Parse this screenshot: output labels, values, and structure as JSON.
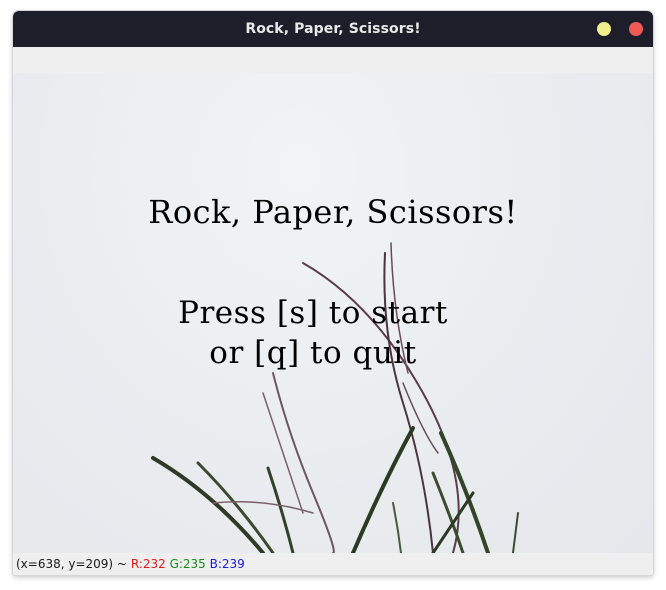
{
  "window": {
    "title": "Rock, Paper, Scissors!"
  },
  "canvas": {
    "game_title": "Rock, Paper, Scissors!",
    "instruction_line1": "Press [s] to start",
    "instruction_line2": "or [q] to quit"
  },
  "status": {
    "coords": "(x=638, y=209) ~",
    "r": "R:232",
    "g": "G:235",
    "b": "B:239"
  },
  "colors": {
    "titlebar": "#1e1e2a",
    "minimize": "#f1f08c",
    "close": "#ef5a57",
    "r_label": "#e01b1b",
    "g_label": "#1c8a1c",
    "b_label": "#1a1ae0"
  },
  "icons": {
    "minimize": "minimize-icon",
    "close": "close-icon"
  }
}
